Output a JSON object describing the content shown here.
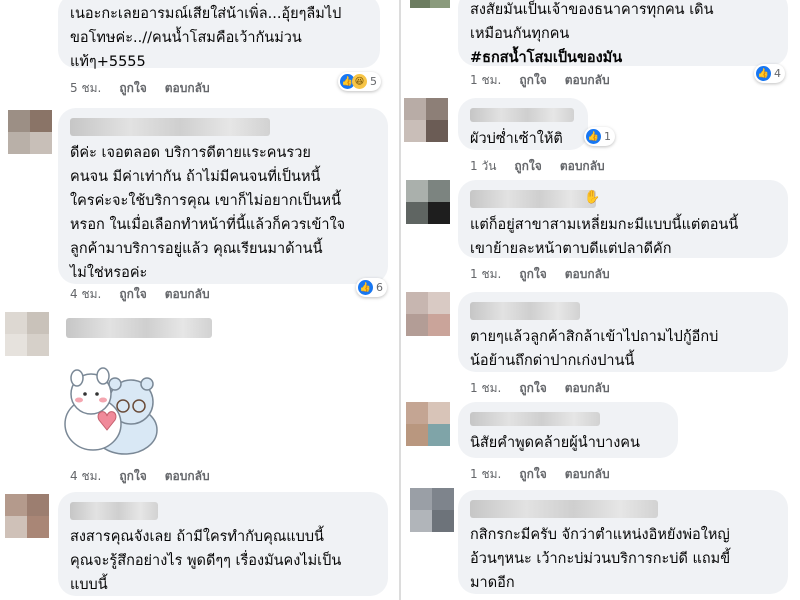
{
  "labels": {
    "like": "ถูกใจ",
    "reply": "ตอบกลับ"
  },
  "left": [
    {
      "text": "เนอะกะเลยอารมณ์เสียใส่น้าเพิ่ล...อุ้ยๆลืมไป\nขอโทษค่ะ..//คนน้ำโสมคือเว้ากันม่วน\nแท้ๆ+5555",
      "time": "5 ชม.",
      "reactions": "5"
    },
    {
      "text": "ดีค่ะ เจอตลอด บริการดีตายแระคนรวย\nคนจน มีค่าเท่ากัน ถ้าไม่มีคนจนที่เป็นหนี้\nใครค่ะจะใช้บริการคุณ เขาก็ไม่อยากเป็นหนี้\nหรอก ในเมื่อเลือกทำหน้าที่นี้แล้วก็ควรเข้าใจ\nลูกค้ามาบริการอยู่แล้ว คุณเรียนมาด้านนี้\nไม่ใช่หรอค่ะ",
      "time": "4 ชม.",
      "reactions": "6"
    },
    {
      "time": "4 ชม."
    },
    {
      "text": "สงสารคุณจังเลย ถ้ามีใครทำกับคุณแบบนี้\nคุณจะรู้สึกอย่างไร พูดดีๆๆ เรื่องมันคงไม่เป็น\nแบบนี้"
    }
  ],
  "right": [
    {
      "text": "สงสัยมันเป็นเจ้าของธนาคารทุกคน เดิน\nเหมือนกันทุกคน",
      "hashtag": "#ธกสน้ำโสมเป็นของมัน",
      "time": "1 ชม.",
      "reactions": "4"
    },
    {
      "text": "ผัวบ่ซ่ำเซ้าให้ติ",
      "time": "1 วัน",
      "reactions": "1"
    },
    {
      "text": "แต่ก็อยู่สาขาสามเหลี่ยมกะมีแบบนี้แต่ตอนนี้\nเขาย้ายละหน้าตาบดีแต่ปลาดีคัก",
      "time": "1 ชม."
    },
    {
      "text": "ตายๆแล้วลูกค้าสิกล้าเข้าไปถามไปกู้อีกบ่\nน้อย้านถึกด่าปากเก่งปานนี้",
      "time": "1 ชม."
    },
    {
      "text": "นิสัยคำพูดคล้ายผู้นำบางคน",
      "time": "1 ชม."
    },
    {
      "text": "กสิกรกะมีครับ จักว่าตำแหน่งอิหยังพ่อใหญ่\nอ้วนๆหนะ เว้ากะบ่ม่วนบริการกะบ่ดี แถมขี้\nมาดอีก"
    }
  ]
}
